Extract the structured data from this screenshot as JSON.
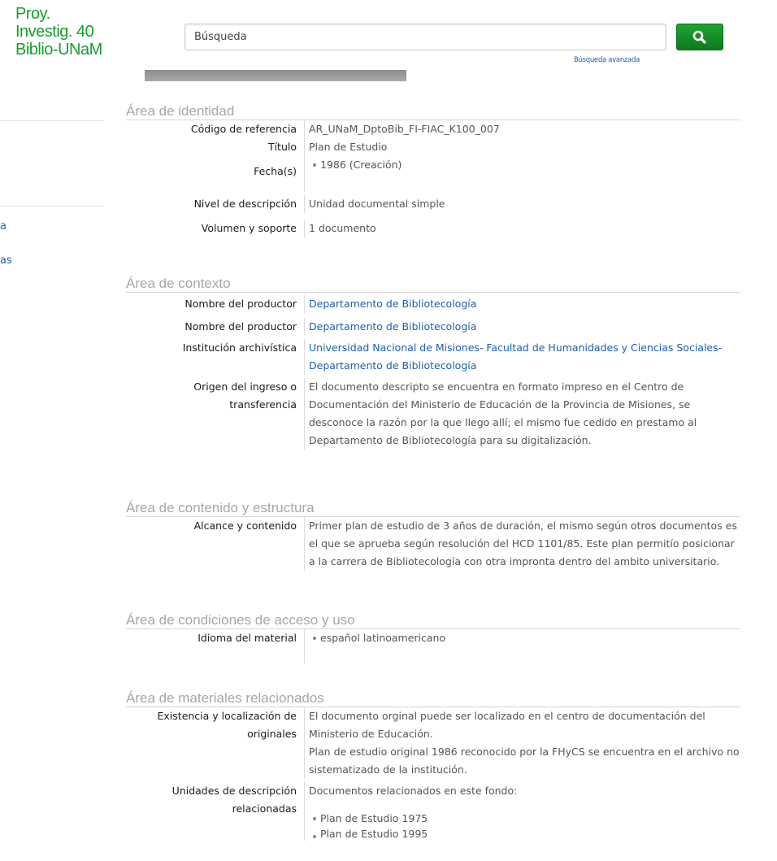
{
  "header": {
    "site_title_lines": [
      "Proy.",
      "Investig. 40",
      "Biblio-UNaM"
    ],
    "search_placeholder": "Búsqueda",
    "advanced_search": "Búsqueda avanzada"
  },
  "colors": {
    "brand_green": "#159f2c",
    "link_blue": "#1a5fb4",
    "section_grey": "#a7a7a7"
  },
  "sidebar": {
    "links": [
      "a",
      "as"
    ]
  },
  "sections": {
    "identity": {
      "title": "Área de identidad",
      "ref_label": "Código de referencia",
      "ref_value": "AR_UNaM_DptoBib_FI-FIAC_K100_007",
      "title_label": "Título",
      "title_value": "Plan de Estudio",
      "dates_label": "Fecha(s)",
      "dates_value": "1986 (Creación)",
      "level_label": "Nivel de descripción",
      "level_value": "Unidad documental simple",
      "extent_label": "Volumen y soporte",
      "extent_value": "1 documento"
    },
    "context": {
      "title": "Área de contexto",
      "creator1_label": "Nombre del productor",
      "creator1_value": "Departamento de Bibliotecología",
      "creator2_label": "Nombre del productor",
      "creator2_value": "Departamento de Bibliotecología",
      "repo_label": "Institución archivística",
      "repo_value": "Universidad Nacional de Misiones- Facultad de Humanidades y Ciencias Sociales- Departamento de Bibliotecología",
      "origin_label": "Origen del ingreso o transferencia",
      "origin_value": "El documento descripto se encuentra en formato impreso en el Centro de Documentación del Ministerio de Educación de la Provincia de Misiones, se desconoce la razón por la que llego allí; el mismo fue cedido en prestamo al Departamento de Bibliotecología para su digitalización."
    },
    "content": {
      "title": "Área de contenido y estructura",
      "scope_label": "Alcance y contenido",
      "scope_value": "Primer plan de estudio de 3 años de duración, el mismo según otros documentos es el que se aprueba según resolución del HCD 1101/85. Este plan permitío posicionar a la carrera de Bibliotecología con otra impronta dentro del ambito universitario."
    },
    "access": {
      "title": "Área de condiciones de acceso y uso",
      "language_label": "Idioma del material",
      "language_value": "español latinoamericano"
    },
    "allied": {
      "title": "Área de materiales relacionados",
      "originals_label": "Existencia y localización de originales",
      "originals_p1": "El documento orginal puede ser localizado en el centro de documentación del Ministerio de Educación.",
      "originals_p2": "Plan de estudio original 1986 reconocido por la FHyCS se encuentra en el archivo no sistematizado de la institución.",
      "related_label": "Unidades de descripción relacionadas",
      "related_intro": "Documentos relacionados en este fondo:",
      "related_items": [
        "Plan de Estudio 1975",
        "Plan de Estudio 1995"
      ]
    }
  }
}
